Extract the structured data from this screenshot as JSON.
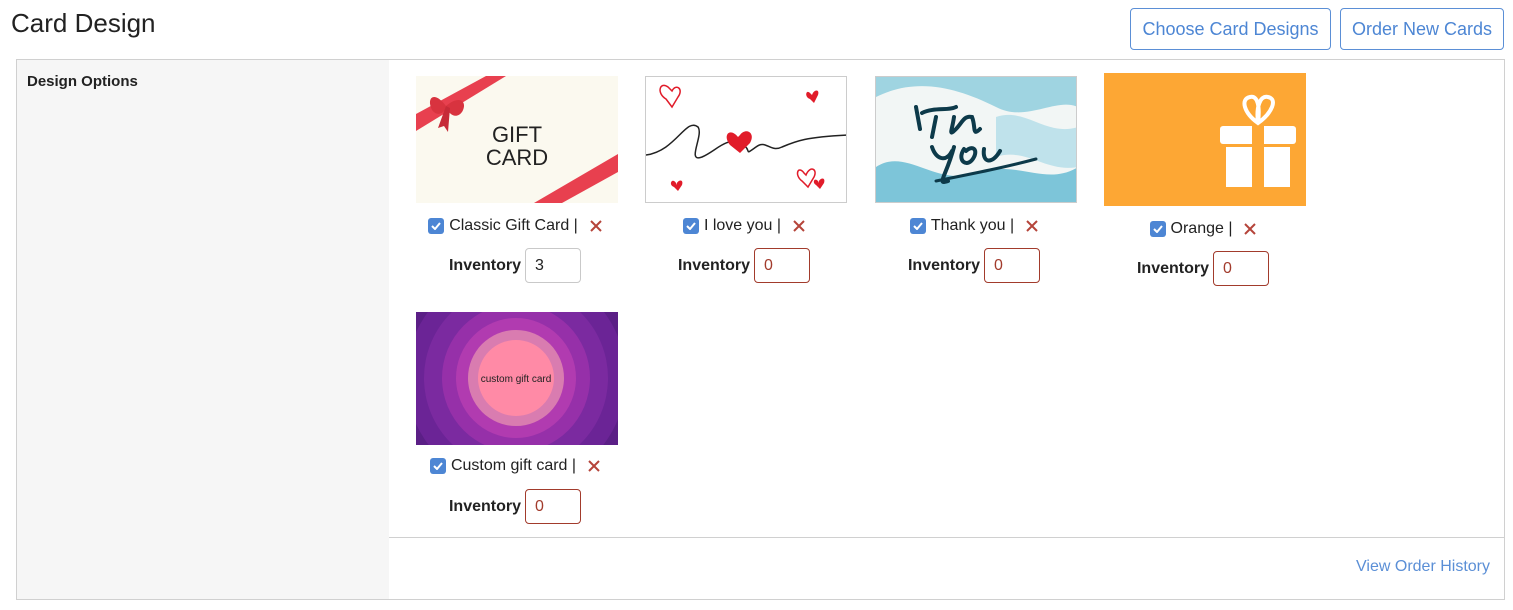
{
  "header": {
    "title": "Card Design",
    "choose_label": "Choose Card Designs",
    "order_label": "Order New Cards"
  },
  "sidebar": {
    "title": "Design Options"
  },
  "cards": [
    {
      "name": "Classic Gift Card |",
      "inventory": "3",
      "checked": true,
      "thumb_text_1": "GIFT",
      "thumb_text_2": "CARD"
    },
    {
      "name": "I love you |",
      "inventory": "0",
      "checked": true
    },
    {
      "name": "Thank you |",
      "inventory": "0",
      "checked": true
    },
    {
      "name": "Orange |",
      "inventory": "0",
      "checked": true
    },
    {
      "name": "Custom gift card |",
      "inventory": "0",
      "checked": true,
      "thumb_text": "custom gift card"
    }
  ],
  "inventory_label": "Inventory",
  "footer": {
    "history_label": "View Order History"
  },
  "colors": {
    "accent": "#4d86d4",
    "error": "#a23b2c",
    "orange": "#fda734",
    "purple": "#7b2aa0"
  }
}
